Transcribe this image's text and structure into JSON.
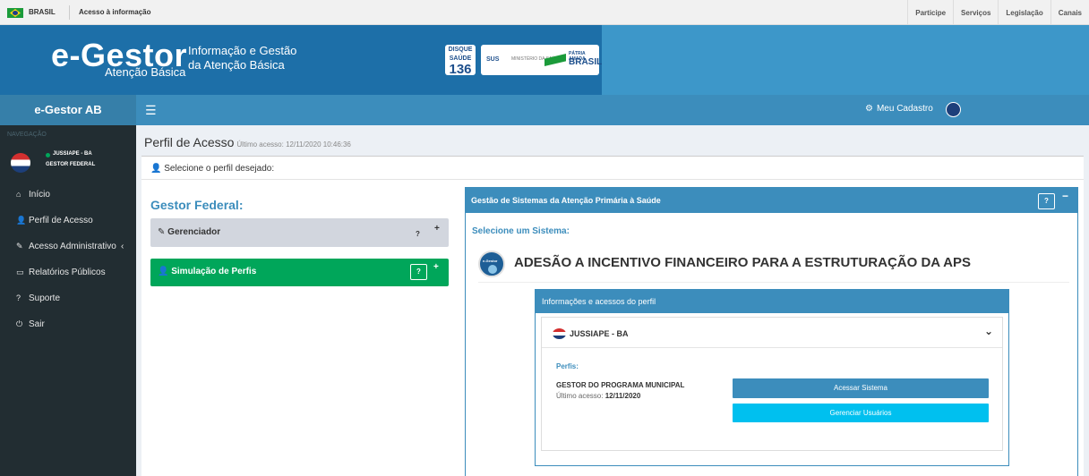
{
  "govbar": {
    "country": "BRASIL",
    "access_info": "Acesso à informação",
    "links": [
      "Participe",
      "Serviços",
      "Legislação",
      "Canais"
    ]
  },
  "banner": {
    "logo": "e-Gestor",
    "logo_sub": "Atenção Básica",
    "tagline_1": "Informação e Gestão",
    "tagline_2": "da Atenção Básica",
    "disque_line1": "DISQUE",
    "disque_line2": "SAÚDE",
    "disque_number": "136",
    "sus": "SUS",
    "ministry": "MINISTÉRIO DA SAÚDE",
    "patria": "PÁTRIA AMADA",
    "brasil": "BRASIL"
  },
  "topnav": {
    "menu_icon": "☰",
    "account_label": "Meu Cadastro"
  },
  "sidebar": {
    "brand": "e-Gestor AB",
    "nav_label": "NAVEGAÇÃO",
    "user_name": "JUSSIAPE - BA",
    "user_role": "GESTOR FEDERAL",
    "items": [
      {
        "label": "Início",
        "icon": "home-icon",
        "glyph": "⌂"
      },
      {
        "label": "Perfil de Acesso",
        "icon": "user-icon",
        "glyph": "👤"
      },
      {
        "label": "Acesso Administrativo",
        "icon": "wrench-icon",
        "glyph": "✎",
        "chevron": "‹"
      },
      {
        "label": "Relatórios Públicos",
        "icon": "laptop-icon",
        "glyph": "▭"
      },
      {
        "label": "Suporte",
        "icon": "question-icon",
        "glyph": "?"
      },
      {
        "label": "Sair",
        "icon": "power-icon",
        "glyph": "⏻"
      }
    ]
  },
  "page": {
    "title": "Perfil de Acesso",
    "last_access": "Último acesso: 12/11/2020 10:46:36",
    "select_profile": "Selecione o perfil desejado:"
  },
  "profiles": {
    "heading": "Gestor Federal:",
    "gerenciador": "Gerenciador",
    "simulacao": "Simulação de Perfis",
    "help": "?",
    "expand": "+"
  },
  "systems": {
    "header": "Gestão de Sistemas da Atenção Primária à Saúde",
    "help": "?",
    "collapse": "−",
    "select_label": "Selecione um Sistema:",
    "logo_text": "e-Gestor",
    "system_title": "ADESÃO A INCENTIVO FINANCEIRO PARA A ESTRUTURAÇÃO DA APS"
  },
  "info_panel": {
    "header": "Informações e acessos do perfil",
    "municipality": "JUSSIAPE - BA",
    "chevron": "⌄",
    "perfis_label": "Perfis:",
    "profile_name": "GESTOR DO PROGRAMA MUNICIPAL",
    "last_access_label": "Último acesso:",
    "last_access_value": "12/11/2020",
    "access_button": "Acessar Sistema",
    "manage_button": "Gerenciar Usuários"
  },
  "colors": {
    "primary": "#3c8dbc",
    "success": "#00a65a",
    "info": "#00c0ef",
    "sidebar": "#222d32"
  }
}
